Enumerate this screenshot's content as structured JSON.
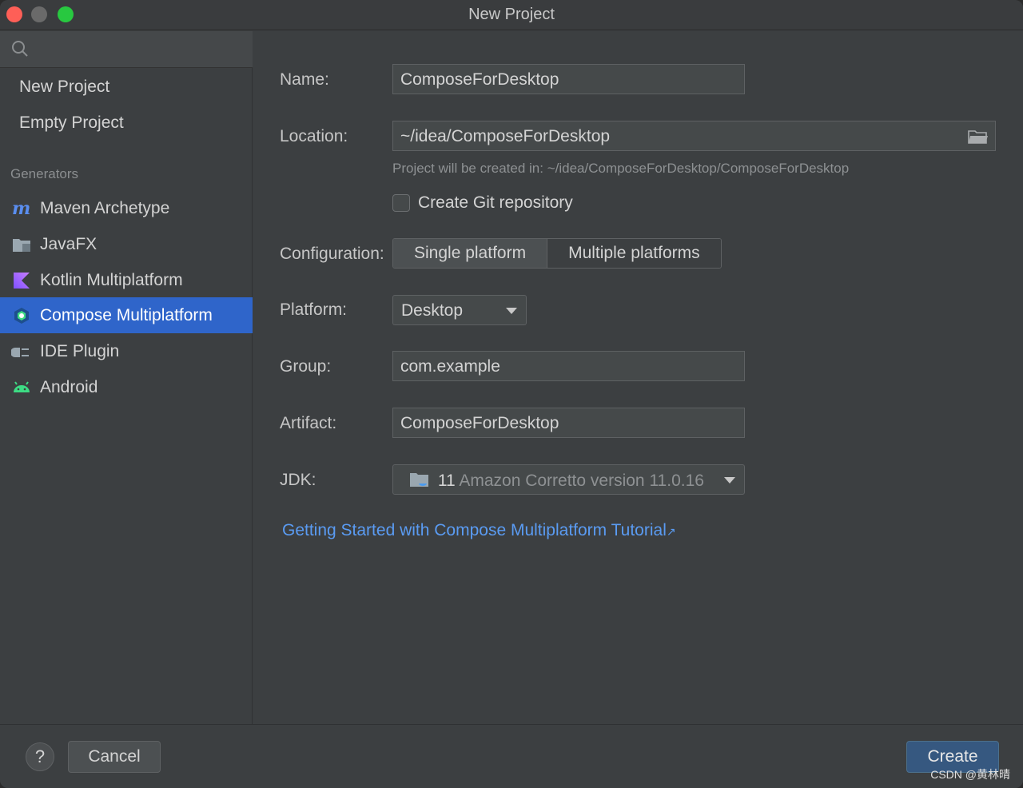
{
  "window": {
    "title": "New Project"
  },
  "sidebar": {
    "search_placeholder": "",
    "top_items": [
      {
        "label": "New Project"
      },
      {
        "label": "Empty Project"
      }
    ],
    "generators_header": "Generators",
    "generators": [
      {
        "label": "Maven Archetype",
        "icon": "maven-icon"
      },
      {
        "label": "JavaFX",
        "icon": "javafx-icon"
      },
      {
        "label": "Kotlin Multiplatform",
        "icon": "kotlin-icon"
      },
      {
        "label": "Compose Multiplatform",
        "icon": "compose-icon",
        "selected": true
      },
      {
        "label": "IDE Plugin",
        "icon": "plugin-icon"
      },
      {
        "label": "Android",
        "icon": "android-icon"
      }
    ]
  },
  "form": {
    "name_label": "Name:",
    "name_value": "ComposeForDesktop",
    "location_label": "Location:",
    "location_value": "~/idea/ComposeForDesktop",
    "location_hint": "Project will be created in: ~/idea/ComposeForDesktop/ComposeForDesktop",
    "git_label": "Create Git repository",
    "git_checked": false,
    "configuration_label": "Configuration:",
    "configuration_options": [
      "Single platform",
      "Multiple platforms"
    ],
    "configuration_selected": "Single platform",
    "platform_label": "Platform:",
    "platform_value": "Desktop",
    "group_label": "Group:",
    "group_value": "com.example",
    "artifact_label": "Artifact:",
    "artifact_value": "ComposeForDesktop",
    "jdk_label": "JDK:",
    "jdk_version": "11",
    "jdk_name": "Amazon Corretto version 11.0.16",
    "tutorial_link": "Getting Started with Compose Multiplatform Tutorial",
    "tutorial_link_arrow": "↗"
  },
  "footer": {
    "help_label": "?",
    "cancel_label": "Cancel",
    "create_label": "Create",
    "watermark": "CSDN @黄林晴"
  },
  "colors": {
    "accent": "#2f65ca",
    "link": "#5a9bf2",
    "background": "#3c3f41"
  }
}
